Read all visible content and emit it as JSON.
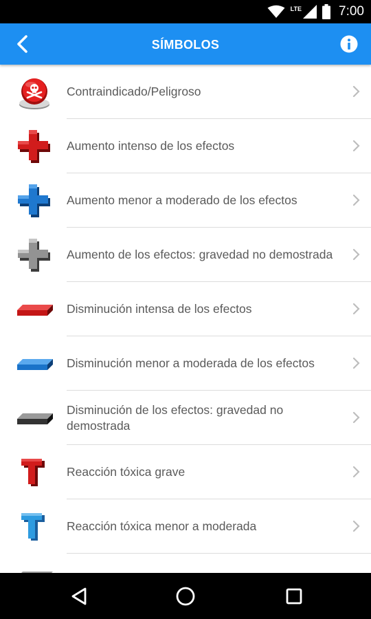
{
  "status_bar": {
    "time": "7:00",
    "network_label": "LTE",
    "icons": [
      "wifi-icon",
      "signal-icon",
      "battery-icon"
    ]
  },
  "app_bar": {
    "title": "SÍMBOLOS",
    "color": "#1d8ff2",
    "back_icon": "chevron-left-icon",
    "info_icon": "info-icon"
  },
  "items": [
    {
      "label": "Contraindicado/Peligroso",
      "icon": "skull-badge-icon",
      "color": "#d41f1f"
    },
    {
      "label": "Aumento intenso de los efectos",
      "icon": "red-plus-icon",
      "color": "#c41616"
    },
    {
      "label": "Aumento menor a moderado de los efectos",
      "icon": "blue-plus-icon",
      "color": "#1a73c9"
    },
    {
      "label": "Aumento de los efectos: gravedad no demostrada",
      "icon": "gray-plus-icon",
      "color": "#8a8a8a"
    },
    {
      "label": "Disminución intensa de los efectos",
      "icon": "red-minus-icon",
      "color": "#c41616"
    },
    {
      "label": "Disminución menor a moderada de los efectos",
      "icon": "blue-minus-icon",
      "color": "#1a73c9"
    },
    {
      "label": "Disminución de los efectos: gravedad no demostrada",
      "icon": "gray-minus-icon",
      "color": "#555555"
    },
    {
      "label": "Reacción tóxica grave",
      "icon": "red-t-icon",
      "color": "#c41616"
    },
    {
      "label": "Reacción tóxica menor a moderada",
      "icon": "blue-t-icon",
      "color": "#2e9be0"
    },
    {
      "label": "",
      "icon": "gray-minus-icon",
      "color": "#555555"
    }
  ],
  "nav_bar": {
    "buttons": [
      "back-triangle-icon",
      "home-circle-icon",
      "recents-square-icon"
    ]
  }
}
